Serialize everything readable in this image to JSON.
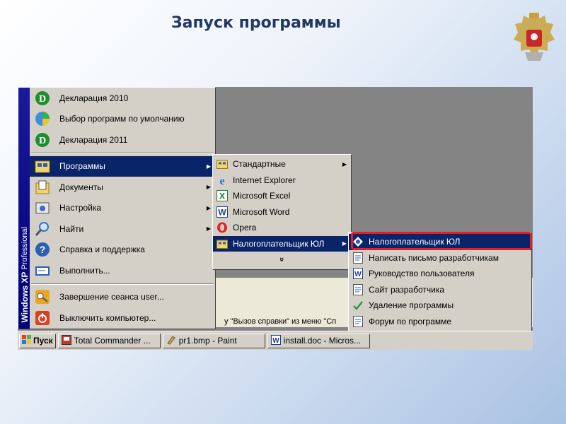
{
  "slide": {
    "title": "Запуск программы",
    "accent_color": "#1f3864",
    "highlight_color": "#e41e26"
  },
  "start_menu": {
    "sidebar_text_bold": "Windows XP",
    "sidebar_text": "Professional",
    "items": [
      {
        "label": "Декларация 2010",
        "icon": "declaration-icon"
      },
      {
        "label": "Выбор программ по умолчанию",
        "icon": "default-programs-icon"
      },
      {
        "label": "Декларация 2011",
        "icon": "declaration-icon"
      },
      {
        "label": "Программы",
        "icon": "programs-folder-icon",
        "submenu": true,
        "selected": true
      },
      {
        "label": "Документы",
        "icon": "documents-icon",
        "submenu": true
      },
      {
        "label": "Настройка",
        "icon": "settings-icon",
        "submenu": true
      },
      {
        "label": "Найти",
        "icon": "search-icon",
        "submenu": true
      },
      {
        "label": "Справка и поддержка",
        "icon": "help-icon"
      },
      {
        "label": "Выполнить...",
        "icon": "run-icon"
      },
      {
        "label": "Завершение сеанса user...",
        "icon": "logoff-icon"
      },
      {
        "label": "Выключить компьютер...",
        "icon": "shutdown-icon"
      }
    ]
  },
  "programs_menu": {
    "items": [
      {
        "label": "Стандартные",
        "icon": "program-group-icon",
        "submenu": true
      },
      {
        "label": "Internet Explorer",
        "icon": "ie-icon"
      },
      {
        "label": "Microsoft Excel",
        "icon": "excel-icon"
      },
      {
        "label": "Microsoft Word",
        "icon": "word-icon"
      },
      {
        "label": "Opera",
        "icon": "opera-icon"
      },
      {
        "label": "Налогоплательщик ЮЛ",
        "icon": "program-group-icon",
        "submenu": true,
        "selected": true
      }
    ],
    "more": "»"
  },
  "taxpayer_menu": {
    "items": [
      {
        "label": "Налогоплательщик ЮЛ",
        "icon": "taxpayer-app-icon",
        "selected": true
      },
      {
        "label": "Написать письмо разработчикам",
        "icon": "doc-icon"
      },
      {
        "label": "Руководство пользователя",
        "icon": "manual-icon"
      },
      {
        "label": "Сайт разработчика",
        "icon": "doc-icon"
      },
      {
        "label": "Удаление программы",
        "icon": "uninstall-icon"
      },
      {
        "label": "Форум по программе",
        "icon": "doc-icon"
      }
    ]
  },
  "background_window": {
    "text": "у \"Вызов справки\" из меню \"Сп"
  },
  "taskbar": {
    "start_label": "Пуск",
    "tasks": [
      {
        "label": "Total Commander ...",
        "icon": "total-commander-icon"
      },
      {
        "label": "pr1.bmp - Paint",
        "icon": "paint-icon"
      },
      {
        "label": "install.doc - Micros...",
        "icon": "word-doc-icon"
      }
    ]
  }
}
